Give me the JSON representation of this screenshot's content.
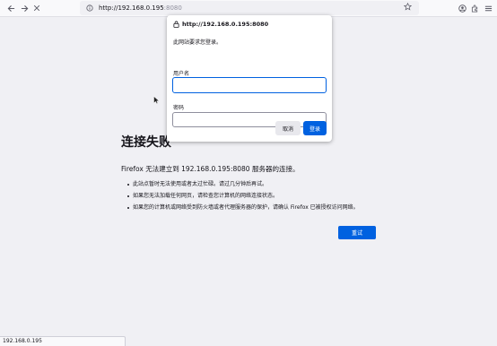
{
  "toolbar": {
    "back_icon": "arrow-left-icon",
    "forward_icon": "arrow-right-icon",
    "close_icon": "close-icon",
    "url_host": "http://192.168.0.195",
    "url_port": ":8080",
    "bookmark_icon": "star-icon",
    "account_icon": "account-icon",
    "extensions_icon": "extensions-icon",
    "menu_icon": "hamburger-menu-icon"
  },
  "error_page": {
    "title": "连接失败",
    "message": "Firefox 无法建立到 192.168.0.195:8080 服务器的连接。",
    "suggestions": [
      "此站点暂时无法使用或者太过忙碌。请过几分钟后再试。",
      "如果您无法加载任何网页，请检查您计算机的网络连接状态。",
      "如果您的计算机或网络受到防火墙或者代理服务器的保护，请确认 Firefox 已被授权访问网络。"
    ],
    "retry_label": "重试"
  },
  "auth_dialog": {
    "origin": "http://192.168.0.195:8080",
    "prompt": "此网站要求您登录。",
    "username_label": "用户名",
    "username_value": "",
    "password_label": "密码",
    "password_value": "",
    "cancel_label": "取消",
    "login_label": "登录"
  },
  "status_bar": {
    "text": "192.168.0.195"
  },
  "colors": {
    "accent": "#0061e0",
    "page_background": "#f0f0f4"
  }
}
